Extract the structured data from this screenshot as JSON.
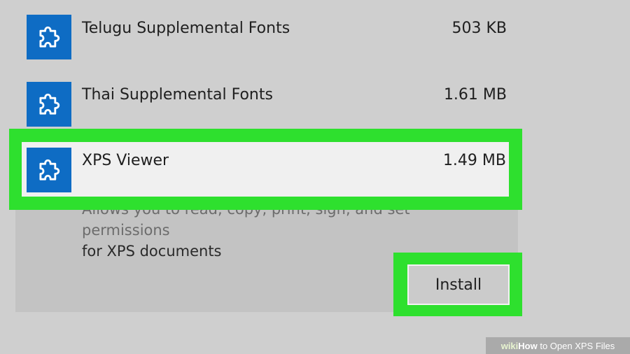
{
  "features": [
    {
      "name": "Telugu Supplemental Fonts",
      "size": "503 KB",
      "icon": "puzzle-piece-icon"
    },
    {
      "name": "Thai Supplemental Fonts",
      "size": "1.61 MB",
      "icon": "puzzle-piece-icon"
    }
  ],
  "selected": {
    "name": "XPS Viewer",
    "size": "1.49 MB",
    "icon": "puzzle-piece-icon",
    "description_line1": "Allows you to read, copy, print, sign, and set permissions",
    "description_line2": "for XPS documents",
    "install_label": "Install"
  },
  "watermark": {
    "wiki": "wiki",
    "how": "How",
    "rest": " to Open XPS Files"
  },
  "colors": {
    "icon_bg": "#0e6cc4",
    "highlight": "#2ee02e",
    "background": "#cfcfcf"
  }
}
